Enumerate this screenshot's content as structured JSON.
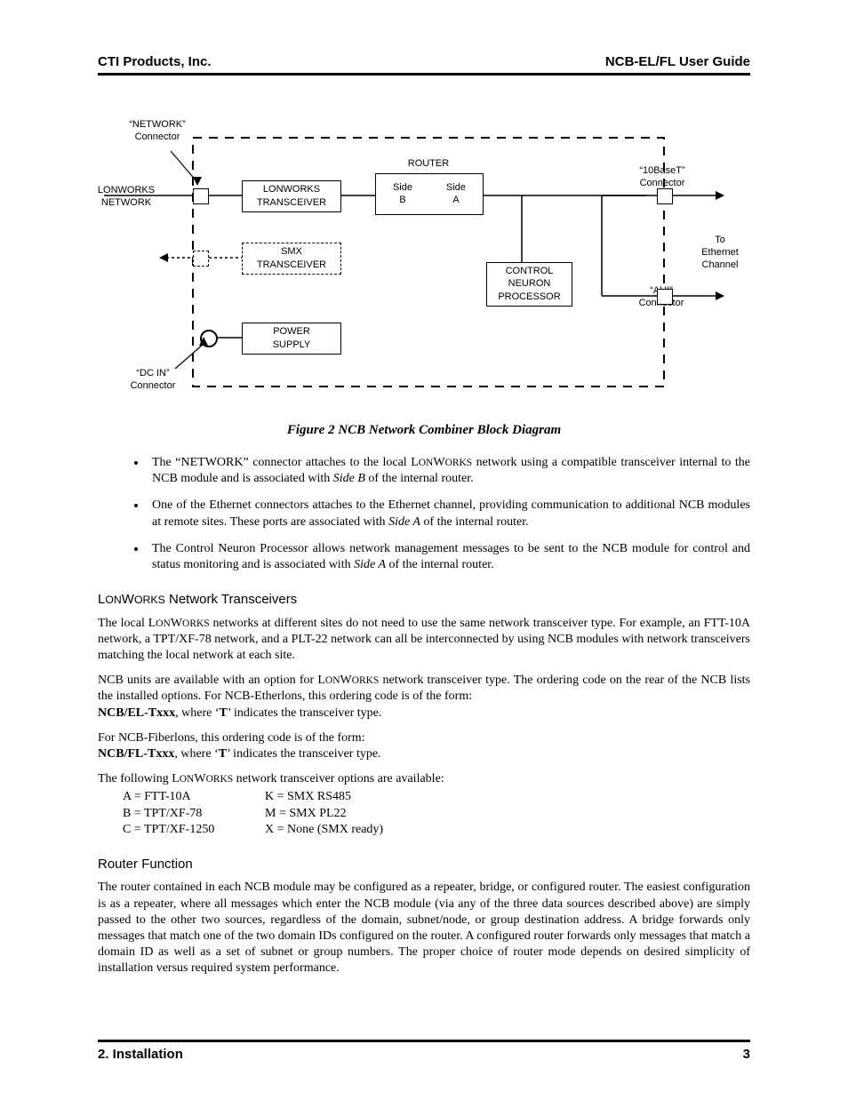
{
  "header": {
    "left": "CTI Products, Inc.",
    "right": "NCB-EL/FL User Guide"
  },
  "footer": {
    "left": "2. Installation",
    "right": "3"
  },
  "diagram": {
    "labels": {
      "network_conn": "“NETWORK”\nConnector",
      "lonworks_net": "LONWORKS\nNETWORK",
      "dc_in": "“DC IN”\nConnector",
      "router": "ROUTER",
      "sideB": "Side\nB",
      "sideA": "Side\nA",
      "tenbaset": "“10BaseT”\nConnector",
      "to_eth": "To\nEthernet\nChannel",
      "aui": "“AUI”\nConnector",
      "lonworks_xcvr": "LONWORKS\nTRANSCEIVER",
      "smx_xcvr": "SMX\nTRANSCEIVER",
      "power": "POWER\nSUPPLY",
      "ctrl": "CONTROL\nNEURON\nPROCESSOR"
    }
  },
  "caption": "Figure 2  NCB Network Combiner Block Diagram",
  "bullets": [
    "The “NETWORK” connector attaches to the local LONWORKS network using a compatible transceiver internal to the NCB module and is associated with Side B of the internal router.",
    "One of the Ethernet connectors attaches to the Ethernet channel, providing communication to additional NCB modules at remote sites.  These ports are associated with Side A of the internal router.",
    "The Control Neuron Processor allows network management messages to be sent to the NCB module for control and status monitoring and is associated with Side A of the internal router."
  ],
  "sec1_heading": "LONWORKS Network Transceivers",
  "sec1_p1": "The local LONWORKS networks at different sites do not need to use the same network transceiver type.  For example, an FTT-10A network, a TPT/XF-78 network, and a PLT-22 network can all be interconnected by using NCB modules with network transceivers matching the local network at each site.",
  "sec1_p2": "NCB units are available with an option for LONWORKS network transceiver type.  The ordering code on the rear of the NCB lists the installed options.  For NCB-Etherlons, this ordering code is of the form:",
  "sec1_code1a": "NCB/EL-Txxx",
  "sec1_code1b": ", where ‘",
  "sec1_code1c": "T",
  "sec1_code1d": "’ indicates the transceiver type.",
  "sec1_p3": "For NCB-Fiberlons, this ordering code is of the form:",
  "sec1_code2a": "NCB/FL-Txxx",
  "sec1_code2b": ", where ‘",
  "sec1_code2c": "T",
  "sec1_code2d": "’ indicates the transceiver type.",
  "sec1_p4": "The following LONWORKS network transceiver options are available:",
  "opts": {
    "a": "A = FTT-10A",
    "k": "K = SMX RS485",
    "b": "B = TPT/XF-78",
    "m": "M = SMX PL22",
    "c": "C = TPT/XF-1250",
    "x": "X = None (SMX ready)"
  },
  "sec2_heading": "Router Function",
  "sec2_p1": "The router contained in each NCB module may be configured as a repeater, bridge, or configured router.  The easiest configuration is as a repeater, where all messages which enter the NCB module (via any of the three data sources described above) are simply passed to the other two sources, regardless of the domain, subnet/node, or group destination address.  A bridge forwards only messages that match one of the two domain IDs configured on the router.  A configured router forwards only messages that match a domain ID as well as a set of subnet or group numbers.  The proper choice of router mode depends on desired simplicity of installation versus required system performance."
}
